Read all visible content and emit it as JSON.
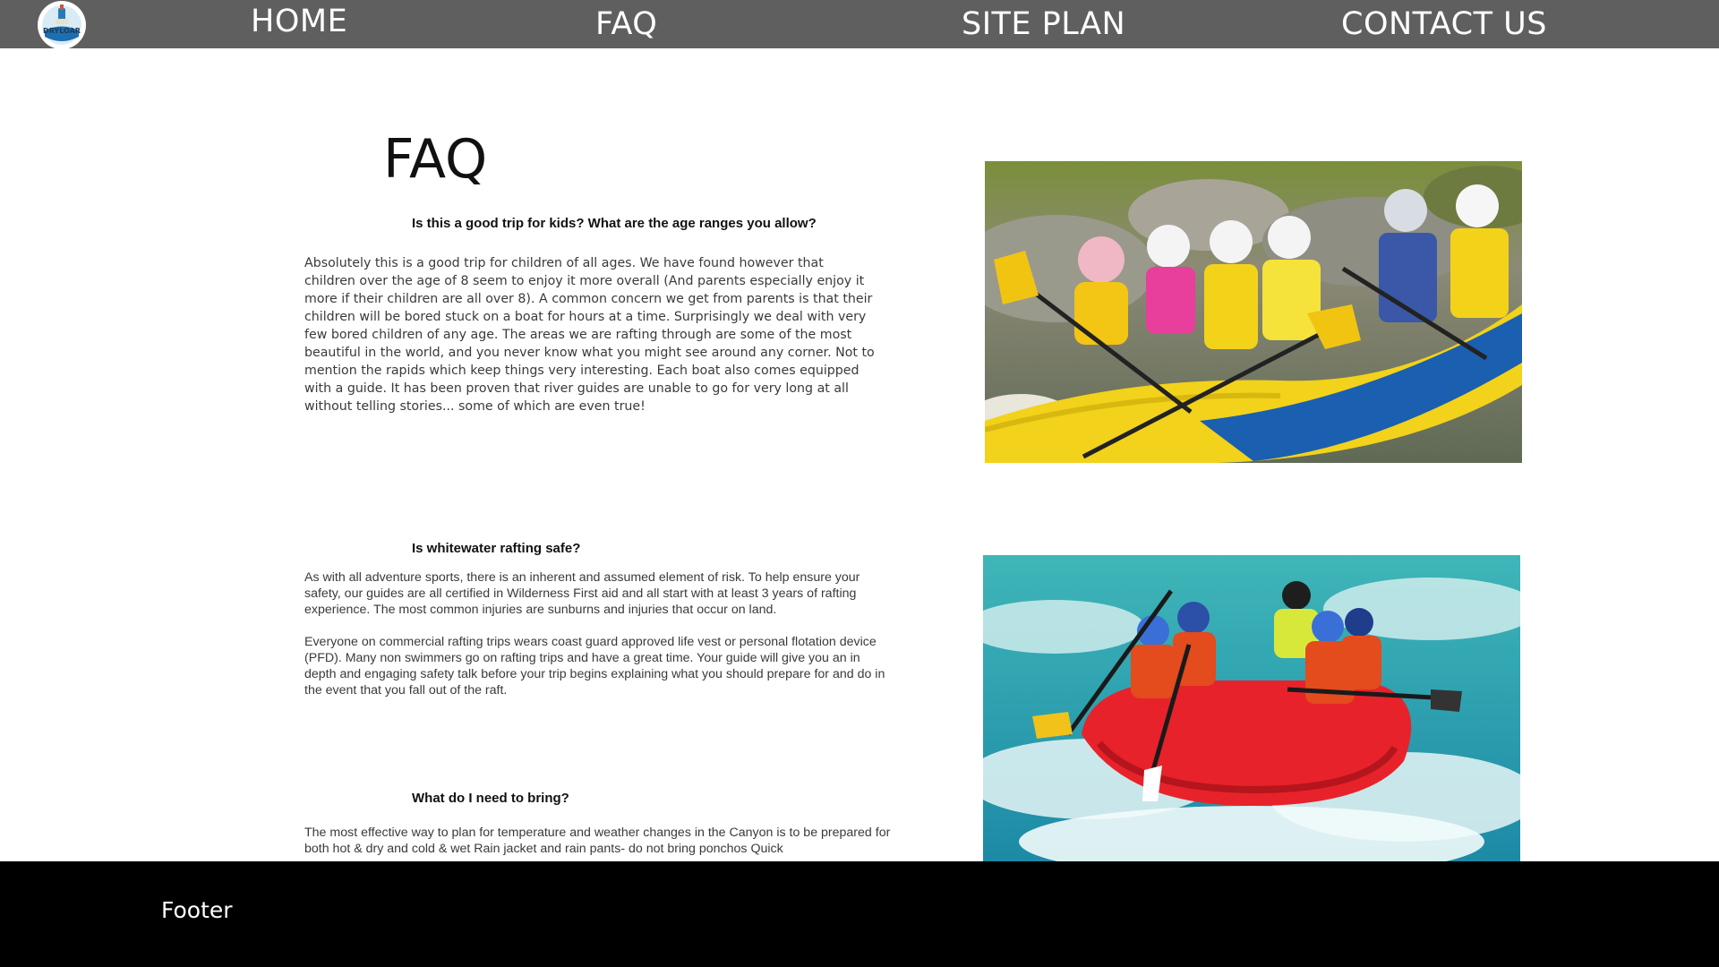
{
  "nav": {
    "logo_text": "DRYLOAR",
    "items": [
      {
        "label": "HOME"
      },
      {
        "label": "FAQ"
      },
      {
        "label": "SITE PLAN"
      },
      {
        "label": "CONTACT US"
      }
    ]
  },
  "main": {
    "title": "FAQ",
    "faqs": [
      {
        "question": "Is this a good trip for kids? What are the age ranges you allow?",
        "answer": "Absolutely this is a good trip for children of all ages. We have found however that children over the age of 8 seem to enjoy it more overall (And parents especially enjoy it more if their children are all over 8). A common concern we get from parents is that their children will be bored stuck on a boat for hours at a time.  Surprisingly we deal with very few bored children of any age. The areas we are rafting through are some of the most beautiful in the world, and you never know what you might see around any corner. Not to mention the rapids which keep things very interesting. Each boat also comes equipped with a guide. It has been proven that river guides are unable to go for very long at all without telling stories... some of which are even true!"
      },
      {
        "question": "Is whitewater rafting safe?",
        "answer_p1": "As with all adventure sports, there is an inherent and assumed element of risk. To help ensure your safety, our guides are all certified in Wilderness First aid and all start with at least 3 years of rafting experience. The most common injuries are sunburns and injuries that occur on land.",
        "answer_p2": "Everyone on commercial rafting trips wears coast guard approved life vest or personal flotation device (PFD). Many non swimmers go on rafting trips and have a great time. Your guide will give you an in depth and engaging safety talk before your trip begins explaining what you should prepare for and do in the event that you fall out of the raft."
      },
      {
        "question": "What do I need to bring?",
        "answer": "The most effective way to plan for temperature and weather changes in the Canyon is to be prepared for both hot & dry and cold & wet Rain jacket and rain pants- do not bring ponchos Quick"
      }
    ],
    "photos": [
      {
        "icon": "rafting-family-photo"
      },
      {
        "icon": "whitewater-raft-photo"
      }
    ]
  },
  "footer": {
    "text": "Footer"
  },
  "colors": {
    "nav_bg": "#5f5f5f",
    "footer_bg": "#000000",
    "text": "#111111"
  }
}
